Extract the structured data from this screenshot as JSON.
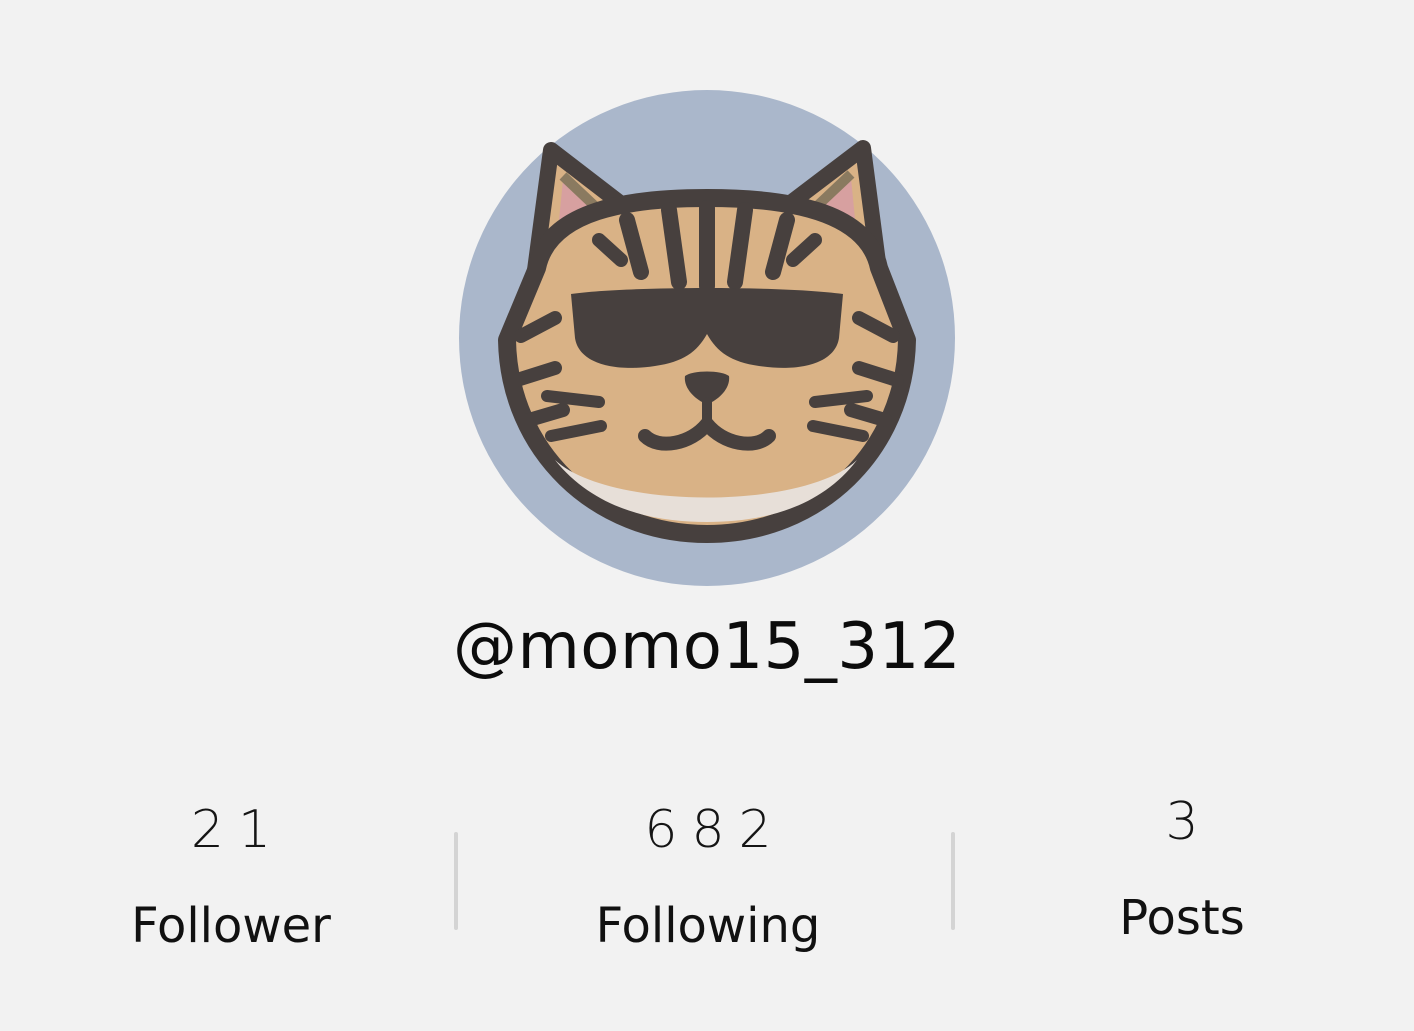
{
  "profile": {
    "username": "@momo15_312",
    "avatar": {
      "icon": "cat-with-sunglasses-icon",
      "background_color": "#aab7cb"
    }
  },
  "stats": [
    {
      "value": "21",
      "label": "Follower"
    },
    {
      "value": "682",
      "label": "Following"
    },
    {
      "value": "3",
      "label": "Posts"
    }
  ],
  "colors": {
    "background": "#f2f2f2",
    "divider": "#d4d4d4",
    "cat_fur": "#d9b286",
    "cat_outline": "#47403e",
    "cat_inner_ear": "#d7a0a0"
  }
}
